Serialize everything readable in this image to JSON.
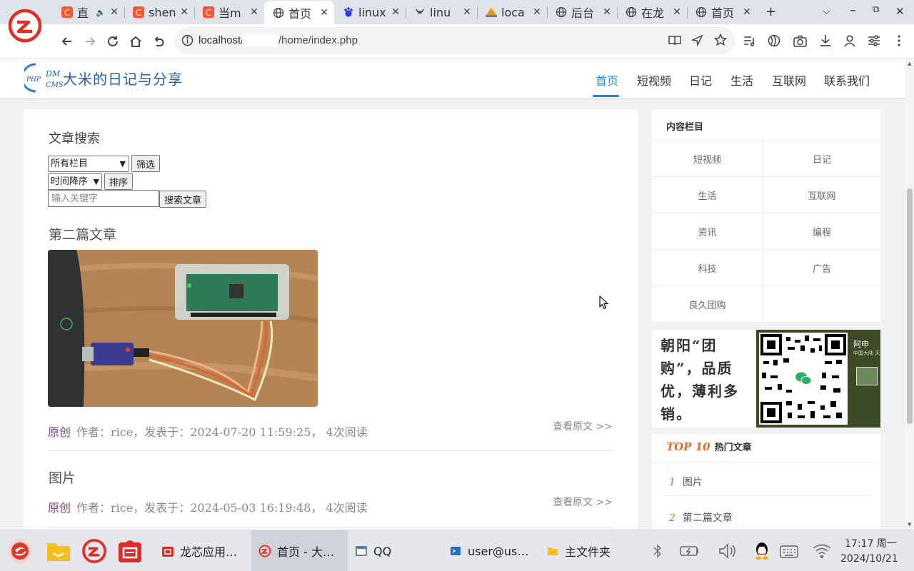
{
  "browser": {
    "tabs": [
      {
        "label": "直",
        "icon": "csdn-icon",
        "has_audio": true
      },
      {
        "label": "shen",
        "icon": "csdn-icon"
      },
      {
        "label": "当m",
        "icon": "csdn-icon"
      },
      {
        "label": "首页",
        "icon": "globe-icon",
        "active": true
      },
      {
        "label": "linux",
        "icon": "baidu-icon"
      },
      {
        "label": "linu",
        "icon": "linux-icon"
      },
      {
        "label": "loca",
        "icon": "phpmyadmin-icon"
      },
      {
        "label": "后台",
        "icon": "globe-icon"
      },
      {
        "label": "在龙",
        "icon": "globe-icon"
      },
      {
        "label": "首页",
        "icon": "globe-icon"
      }
    ],
    "new_tab": "+",
    "url_host": "localhost/",
    "url_path": "/home/index.php"
  },
  "site": {
    "logo_text": "PHP DM CMS",
    "title": "大米的日记与分享",
    "nav": [
      "首页",
      "短视频",
      "日记",
      "生活",
      "互联网",
      "联系我们"
    ],
    "nav_active": "首页"
  },
  "search": {
    "title": "文章搜索",
    "category_select": "所有栏目",
    "filter_button": "筛选",
    "order_select": "时间降序",
    "sort_button": "排序",
    "keyword_placeholder": "输入关键字",
    "search_button": "搜索文章"
  },
  "articles": [
    {
      "title": "第二篇文章",
      "tag": "原创",
      "meta": "作者：rice，发表于：2024-07-20 11:59:25， 4次阅读",
      "read_more": "查看原文 >>"
    },
    {
      "title": "图片",
      "tag": "原创",
      "meta": "作者：rice，发表于：2024-05-03 16:19:48， 4次阅读",
      "read_more": "查看原文 >>"
    }
  ],
  "sidebar": {
    "title": "内容栏目",
    "categories": [
      "短视频",
      "日记",
      "生活",
      "互联网",
      "资讯",
      "编程",
      "科技",
      "广告",
      "良久团购",
      ""
    ],
    "ad": {
      "text": "朝阳“团购”，品质优，薄利多销。",
      "name": "阿申",
      "sub": "中国大陆 天"
    },
    "top10": {
      "highlight": "TOP 10",
      "label": "热门文章",
      "items": [
        {
          "num": "1",
          "title": "图片"
        },
        {
          "num": "2",
          "title": "第二篇文章"
        }
      ]
    }
  },
  "taskbar": {
    "tasks": [
      {
        "label": "龙芯应用…",
        "icon": "app-store-icon"
      },
      {
        "label": "首页 - 大…",
        "icon": "browser-icon",
        "active": true
      },
      {
        "label": "QQ",
        "icon": "window-icon"
      },
      {
        "label": "user@us…",
        "icon": "terminal-icon"
      },
      {
        "label": "主文件夹",
        "icon": "folder-icon"
      }
    ],
    "time": "17:17 周一",
    "date": "2024/10/21"
  },
  "colors": {
    "accent": "#1f8ad8",
    "tag": "#7d3e8c",
    "top10": "#e06a25",
    "ad_green": "#3d4a26"
  }
}
